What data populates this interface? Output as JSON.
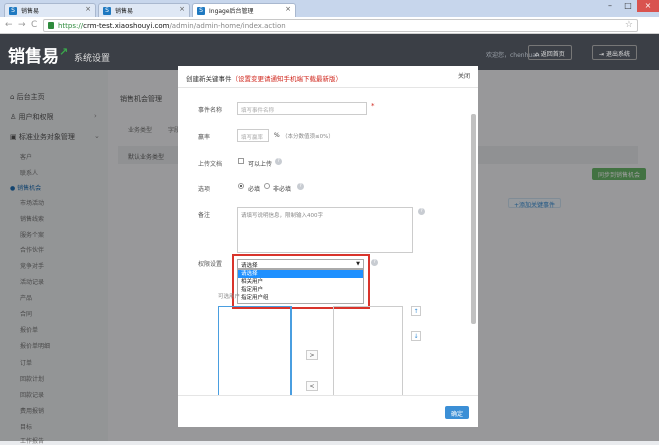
{
  "browser": {
    "tabs": [
      {
        "label": "销售易"
      },
      {
        "label": "销售易"
      },
      {
        "label": "Ingage后台管理"
      }
    ],
    "url_protocol": "https://",
    "url_host": "crm-test.xiaoshouyi.com",
    "url_path": "/admin/admin-home/index.action"
  },
  "header": {
    "logo": "销售易",
    "subtitle": "系统设置",
    "welcome": "欢迎您，chenhuan",
    "home_btn": "返回首页",
    "logout_btn": "退出系统"
  },
  "sidebar": {
    "items": [
      {
        "label": "后台主页",
        "type": "main"
      },
      {
        "label": "用户和权限",
        "type": "main"
      },
      {
        "label": "标准业务对象管理",
        "type": "main"
      },
      {
        "label": "客户",
        "type": "sub"
      },
      {
        "label": "联系人",
        "type": "sub"
      },
      {
        "label": "销售机会",
        "type": "sub-active"
      },
      {
        "label": "市场活动",
        "type": "sub"
      },
      {
        "label": "销售线索",
        "type": "sub"
      },
      {
        "label": "服务个案",
        "type": "sub"
      },
      {
        "label": "合作伙伴",
        "type": "sub"
      },
      {
        "label": "竞争对手",
        "type": "sub"
      },
      {
        "label": "活动记录",
        "type": "sub"
      },
      {
        "label": "产品",
        "type": "sub"
      },
      {
        "label": "合同",
        "type": "sub"
      },
      {
        "label": "报价单",
        "type": "sub"
      },
      {
        "label": "报价单明细",
        "type": "sub"
      },
      {
        "label": "订单",
        "type": "sub"
      },
      {
        "label": "回款计划",
        "type": "sub"
      },
      {
        "label": "回款记录",
        "type": "sub"
      },
      {
        "label": "费用报销",
        "type": "sub"
      },
      {
        "label": "目标",
        "type": "sub"
      },
      {
        "label": "工作报告",
        "type": "sub"
      }
    ]
  },
  "main": {
    "crumb": "销售机会管理",
    "tabs": [
      "业务类型",
      "字段"
    ],
    "row_label": "默认业务类型",
    "green_btn": "同步到销售机会",
    "add_key_btn": "+添加关键事件"
  },
  "modal": {
    "title": "创建新关键事件",
    "title_note": "（设置变更请通知手机端下载最新版）",
    "close": "关闭",
    "name_label": "事件名称",
    "name_placeholder": "填写事件名称",
    "progress_label": "赢率",
    "progress_placeholder": "填写赢率",
    "progress_unit": "%",
    "progress_hint": "（本分数值须≤0%）",
    "upload_label": "上传文档",
    "upload_option": "可以上传",
    "option_label": "选项",
    "opt_required": "必填",
    "opt_optional": "非必填",
    "note_label": "备注",
    "note_placeholder": "请填写说明信息，限制输入400字",
    "perm_label": "权限设置",
    "select_value": "请选择",
    "select_options": [
      "请选择",
      "相关用户",
      "指定用户",
      "指定用户组"
    ],
    "available_label": "可选用户",
    "move_right": ">",
    "move_left": "<",
    "up": "↑",
    "down": "↓",
    "ok": "确定"
  }
}
